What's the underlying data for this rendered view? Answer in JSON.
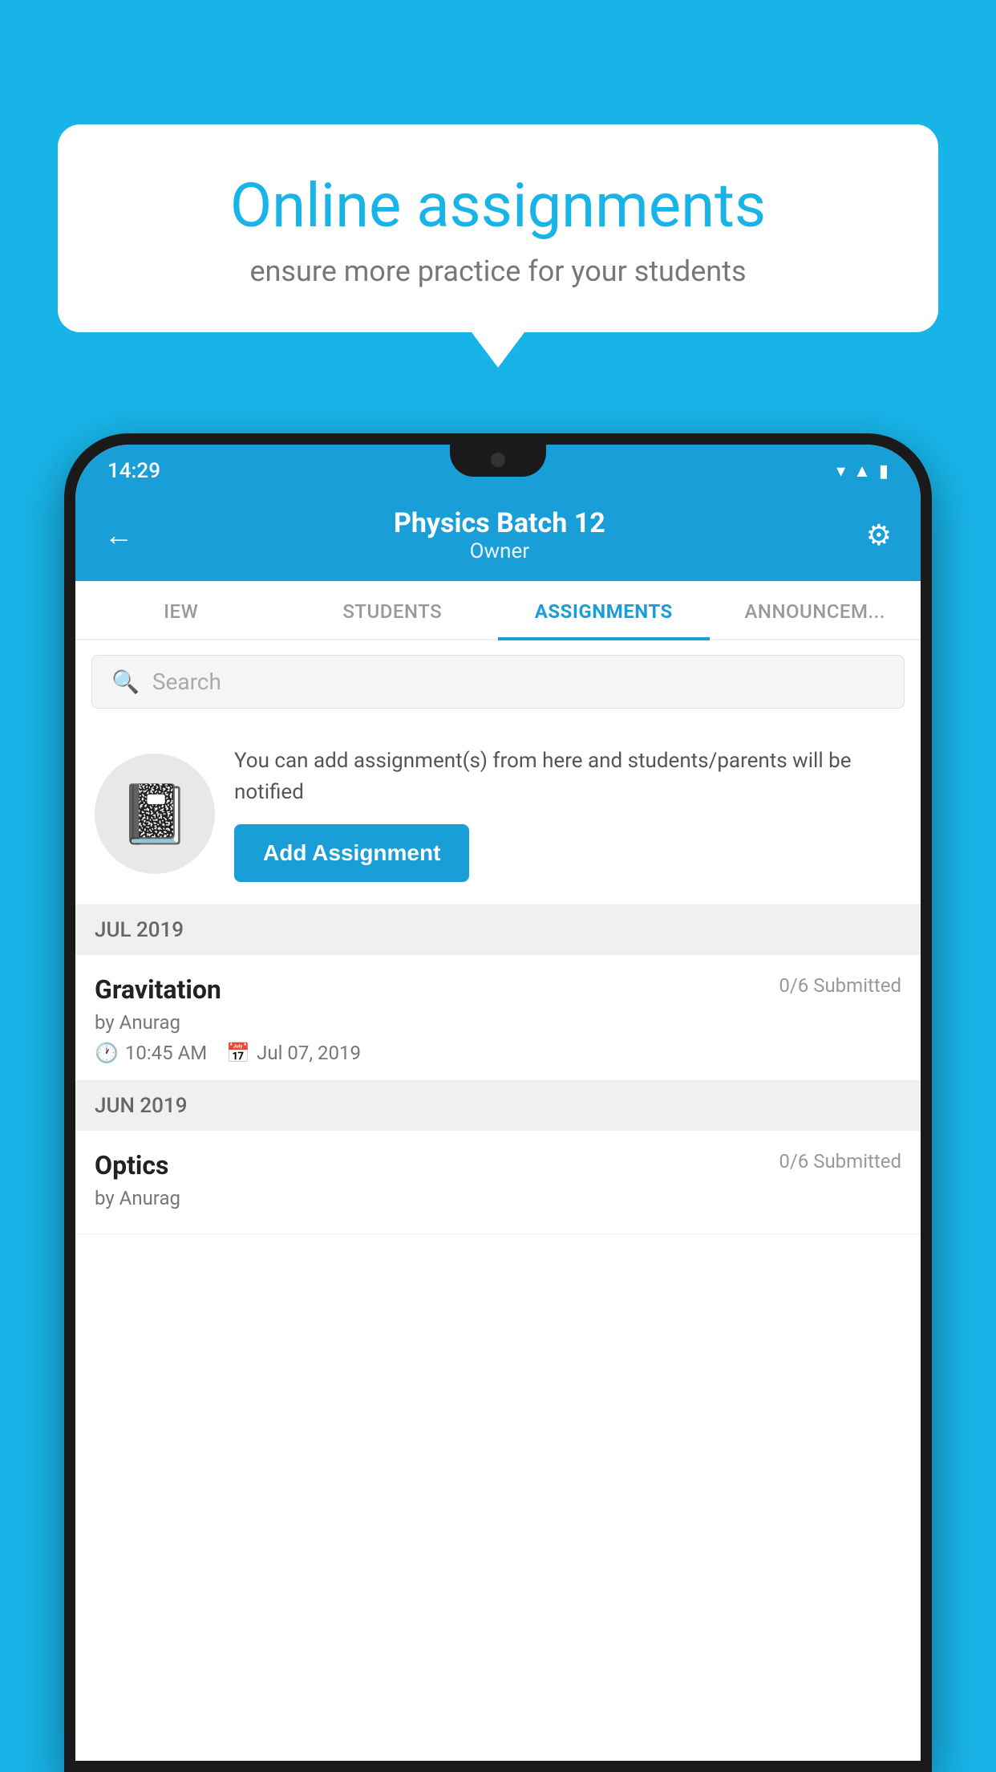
{
  "background_color": "#18b4e8",
  "speech_bubble": {
    "title": "Online assignments",
    "subtitle": "ensure more practice for your students"
  },
  "status_bar": {
    "time": "14:29",
    "icons": [
      "wifi",
      "signal",
      "battery"
    ]
  },
  "app_bar": {
    "title": "Physics Batch 12",
    "subtitle": "Owner",
    "back_label": "←",
    "settings_label": "⚙"
  },
  "tabs": [
    {
      "label": "IEW",
      "active": false
    },
    {
      "label": "STUDENTS",
      "active": false
    },
    {
      "label": "ASSIGNMENTS",
      "active": true
    },
    {
      "label": "ANNOUNCEM...",
      "active": false
    }
  ],
  "search": {
    "placeholder": "Search"
  },
  "promo": {
    "description": "You can add assignment(s) from here and students/parents will be notified",
    "button_label": "Add Assignment"
  },
  "sections": [
    {
      "header": "JUL 2019",
      "assignments": [
        {
          "name": "Gravitation",
          "submitted": "0/6 Submitted",
          "by": "by Anurag",
          "time": "10:45 AM",
          "date": "Jul 07, 2019"
        }
      ]
    },
    {
      "header": "JUN 2019",
      "assignments": [
        {
          "name": "Optics",
          "submitted": "0/6 Submitted",
          "by": "by Anurag",
          "time": "",
          "date": ""
        }
      ]
    }
  ]
}
